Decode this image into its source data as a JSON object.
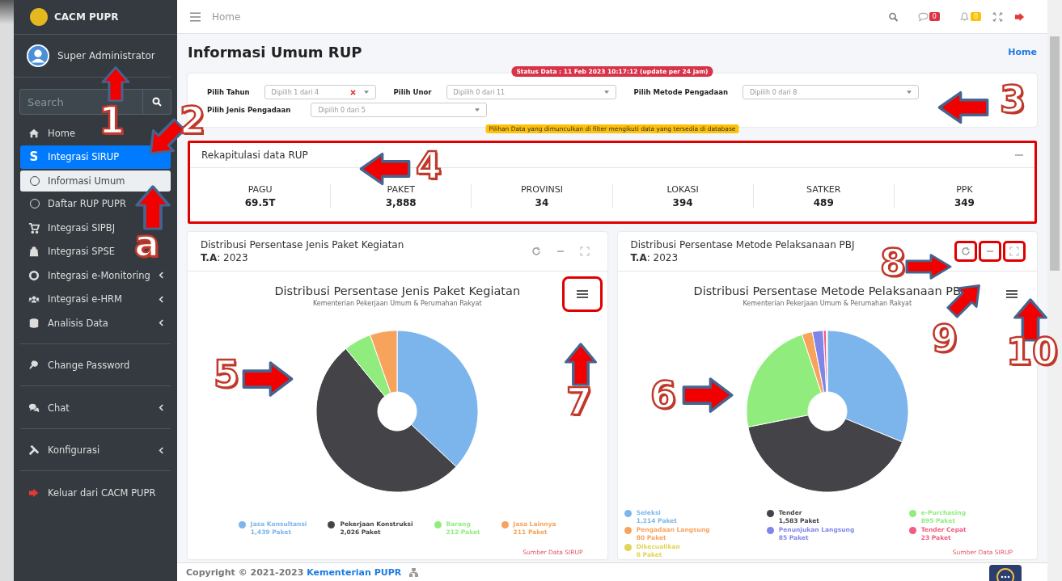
{
  "brand": {
    "name": "CACM PUPR"
  },
  "user": {
    "name": "Super Administrator"
  },
  "sidebar_search": {
    "placeholder": "Search"
  },
  "menu_groups": [
    {
      "items": [
        {
          "label": "Home",
          "selected": false
        },
        {
          "label": "Integrasi SIRUP",
          "icon_text": "S",
          "selected": true,
          "children": [
            {
              "label": "Informasi Umum",
              "selected": true
            },
            {
              "label": "Daftar RUP PUPR",
              "selected": false
            }
          ]
        },
        {
          "label": "Integrasi SIPBJ",
          "selected": false
        },
        {
          "label": "Integrasi SPSE",
          "selected": false
        },
        {
          "label": "Integrasi e-Monitoring",
          "selected": false,
          "expandable": true
        },
        {
          "label": "Integrasi e-HRM",
          "selected": false,
          "expandable": true
        },
        {
          "label": "Analisis Data",
          "selected": false,
          "expandable": true
        }
      ]
    },
    {
      "items": [
        {
          "label": "Change Password",
          "selected": false
        }
      ]
    },
    {
      "items": [
        {
          "label": "Chat",
          "selected": false,
          "expandable": true
        }
      ]
    },
    {
      "items": [
        {
          "label": "Konfigurasi",
          "selected": false,
          "expandable": true
        }
      ]
    },
    {
      "items": [
        {
          "label": "Keluar dari CACM PUPR",
          "selected": false
        }
      ]
    }
  ],
  "topbar": {
    "breadcrumb": "Home",
    "messages_badge": "0",
    "notifications_badge": "0"
  },
  "page": {
    "title": "Informasi Umum RUP",
    "breadcrumb_link": "Home"
  },
  "status": "Status Data : 11 Feb 2023 10:17:12 (update per 24 jam)",
  "filters": [
    {
      "label": "Pilih Tahun",
      "placeholder": "Dipilih 1 dari 4",
      "clearable": true
    },
    {
      "label": "Pilih Unor",
      "placeholder": "Dipilih 0 dari 11",
      "clearable": false
    },
    {
      "label": "Pilih Metode Pengadaan",
      "placeholder": "Dipilih 0 dari 8",
      "clearable": false
    },
    {
      "label": "Pilih Jenis Pengadaan",
      "placeholder": "Dipilih 0 dari 5",
      "clearable": false
    }
  ],
  "filter_note": "Pilihan Data yang dimunculkan di filter mengikuti data yang tersedia di database",
  "summary": {
    "title": "Rekapitulasi data RUP",
    "stats": [
      {
        "label": "PAGU",
        "value": "69.5T"
      },
      {
        "label": "PAKET",
        "value": "3,888"
      },
      {
        "label": "PROVINSI",
        "value": "34"
      },
      {
        "label": "LOKASI",
        "value": "394"
      },
      {
        "label": "SATKER",
        "value": "489"
      },
      {
        "label": "PPK",
        "value": "349"
      }
    ]
  },
  "charts": [
    {
      "title": "Distribusi Persentase Jenis Paket Kegiatan",
      "year": "**T.A**: 2023",
      "subtitle": "Kementerian Pekerjaan Umum & Perumahan Rakyat",
      "source": "Sumber Data SIRUP",
      "chart_data": {
        "type": "donut",
        "title": "Distribusi Persentase Jenis Paket Kegiatan",
        "legend": "bottom",
        "categories": [
          "Jasa Konsultansi",
          "Pekerjaan Konstruksi",
          "Barang",
          "Jasa Lainnya"
        ],
        "series": [
          {
            "colors": [
              "#7cb5ec",
              "#434348",
              "#90ed7d",
              "#f7a35c"
            ],
            "values": [
              37.0,
              52.1,
              5.5,
              5.4
            ]
          }
        ]
      },
      "legend_counts": [
        "1,439 Paket",
        "2,026 Paket",
        "212 Paket",
        "211 Paket"
      ]
    },
    {
      "title": "Distribusi Persentase Metode Pelaksanaan PBJ",
      "year": "**T.A**: 2023",
      "subtitle": "Kementerian Pekerjaan Umum & Perumahan Rakyat",
      "source": "Sumber Data SIRUP",
      "chart_data": {
        "type": "donut",
        "title": "Distribusi Persentase Metode Pelaksanaan PB",
        "legend": "bottom",
        "categories": [
          "Seleksi",
          "Tender",
          "e-Purchasing",
          "Pengadaan Langsung",
          "Penunjukan Langsung",
          "Tender Cepat",
          "Dikecualikan"
        ],
        "series": [
          {
            "colors": [
              "#7cb5ec",
              "#434348",
              "#90ed7d",
              "#f7a35c",
              "#8085e9",
              "#f15c80",
              "#e4d354"
            ],
            "values": [
              31.2,
              40.7,
              23.0,
              2.1,
              2.2,
              0.6,
              0.2
            ]
          }
        ]
      },
      "legend_counts": [
        "1,214 Paket",
        "1,583 Paket",
        "895 Paket",
        "80 Paket",
        "85 Paket",
        "23 Paket",
        "8 Paket"
      ]
    }
  ],
  "footer": {
    "text": "Copyright © 2021-2023",
    "link": "Kementerian PUPR"
  },
  "annotations": [
    {
      "label": "1"
    },
    {
      "label": "2"
    },
    {
      "label": "3"
    },
    {
      "label": "4"
    },
    {
      "label": "5"
    },
    {
      "label": "6"
    },
    {
      "label": "7"
    },
    {
      "label": "8"
    },
    {
      "label": "9"
    },
    {
      "label": "10"
    },
    {
      "label": "a"
    }
  ]
}
